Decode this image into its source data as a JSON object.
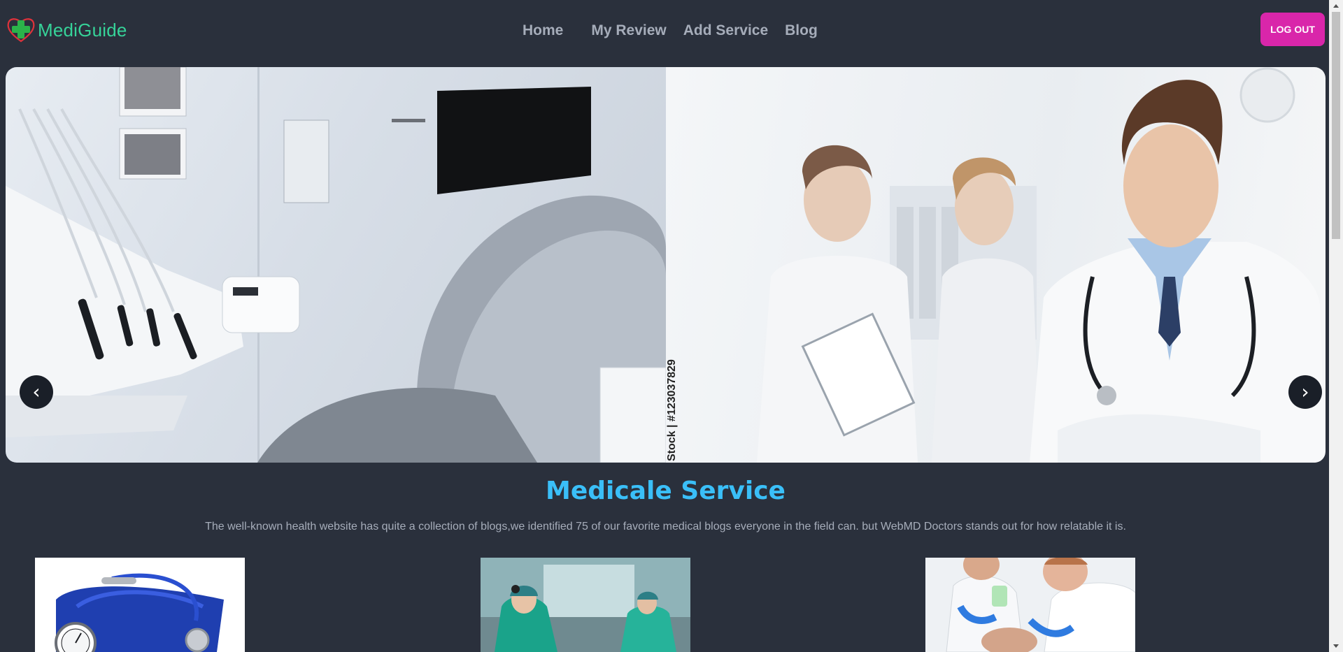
{
  "brand": {
    "name": "MediGuide",
    "logo_icon": "medical-cross-heart-icon"
  },
  "nav": {
    "items": [
      {
        "label": "Home"
      },
      {
        "label": "My Review"
      },
      {
        "label": "Add Service"
      },
      {
        "label": "Blog"
      }
    ],
    "logout_label": "LOG OUT"
  },
  "carousel": {
    "prev_label": "‹",
    "next_label": "›",
    "slide_credit": "Stock | #123037829"
  },
  "section": {
    "title": "Medicale Service",
    "description": "The well-known health website has quite a collection of blogs,we identified 75 of our favorite medical blogs everyone in the field can. but WebMD Doctors stands out for how relatable it is."
  },
  "colors": {
    "background": "#2a303c",
    "brand": "#36d399",
    "accent_button": "#d926aa",
    "title": "#3abff8"
  }
}
